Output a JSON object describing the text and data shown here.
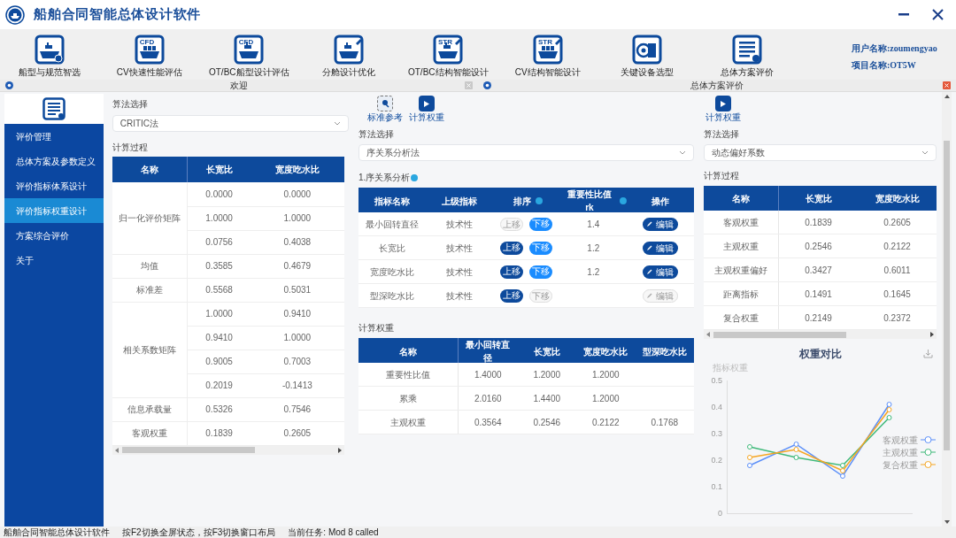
{
  "window": {
    "title": "船舶合同智能总体设计软件"
  },
  "toolbar": [
    {
      "label": "船型与规范智选"
    },
    {
      "label": "CV快速性能评估",
      "badge": "CFD"
    },
    {
      "label": "OT/BC船型设计评估",
      "badge": "CFD"
    },
    {
      "label": "分舱设计优化"
    },
    {
      "label": "OT/BC结构智能设计",
      "badge": "STR"
    },
    {
      "label": "CV结构智能设计",
      "badge": "STR"
    },
    {
      "label": "关键设备选型"
    },
    {
      "label": "总体方案评价"
    }
  ],
  "user": {
    "user_name": "用户名称:zoumengyao",
    "project_name": "项目名称:OT5W"
  },
  "panes": [
    {
      "title": "欢迎",
      "active": false
    },
    {
      "title": "总体方案评价",
      "active": true
    }
  ],
  "sidebar": {
    "items": [
      {
        "label": "评价管理",
        "selected": false
      },
      {
        "label": "总体方案及参数定义",
        "selected": false
      },
      {
        "label": "评价指标体系设计",
        "selected": false
      },
      {
        "label": "评价指标权重设计",
        "selected": true
      },
      {
        "label": "方案综合评价",
        "selected": false
      },
      {
        "label": "关于",
        "selected": false
      }
    ]
  },
  "critic": {
    "algorithm_label": "算法选择",
    "algorithm": "CRITIC法",
    "process_label": "计算过程",
    "columns": [
      "名称",
      "长宽比",
      "宽度吃水比"
    ],
    "groups": [
      {
        "name": "归一化评价矩阵",
        "rows": [
          [
            "0.0000",
            "0.0000"
          ],
          [
            "1.0000",
            "1.0000"
          ],
          [
            "0.0756",
            "0.4038"
          ]
        ]
      },
      {
        "name": "均值",
        "rows": [
          [
            "0.3585",
            "0.4679"
          ]
        ]
      },
      {
        "name": "标准差",
        "rows": [
          [
            "0.5568",
            "0.5031"
          ]
        ]
      },
      {
        "name": "相关系数矩阵",
        "rows": [
          [
            "1.0000",
            "0.9410"
          ],
          [
            "0.9410",
            "1.0000"
          ],
          [
            "0.9005",
            "0.7003"
          ],
          [
            "0.2019",
            "-0.1413"
          ]
        ]
      },
      {
        "name": "信息承载量",
        "rows": [
          [
            "0.5326",
            "0.7546"
          ]
        ]
      },
      {
        "name": "客观权重",
        "rows": [
          [
            "0.1839",
            "0.2605"
          ]
        ]
      }
    ]
  },
  "order": {
    "tools": [
      {
        "label": "标准参考"
      },
      {
        "label": "计算权重"
      }
    ],
    "algorithm_label": "算法选择",
    "algorithm": "序关系分析法",
    "section": "1.序关系分析",
    "columns": [
      {
        "label": "指标名称"
      },
      {
        "label": "上级指标"
      },
      {
        "label": "排序",
        "help": true
      },
      {
        "label": "重要性比值rk",
        "help": true
      },
      {
        "label": "操作"
      }
    ],
    "rows": [
      {
        "name": "最小回转直径",
        "parent": "技术性",
        "up": {
          "label": "上移",
          "disabled": true
        },
        "down": {
          "label": "下移",
          "disabled": false
        },
        "rk": "1.4",
        "edit": {
          "label": "编辑",
          "disabled": false
        }
      },
      {
        "name": "长宽比",
        "parent": "技术性",
        "up": {
          "label": "上移",
          "disabled": false
        },
        "down": {
          "label": "下移",
          "disabled": false
        },
        "rk": "1.2",
        "edit": {
          "label": "编辑",
          "disabled": false
        }
      },
      {
        "name": "宽度吃水比",
        "parent": "技术性",
        "up": {
          "label": "上移",
          "disabled": false
        },
        "down": {
          "label": "下移",
          "disabled": false
        },
        "rk": "1.2",
        "edit": {
          "label": "编辑",
          "disabled": false
        }
      },
      {
        "name": "型深吃水比",
        "parent": "技术性",
        "up": {
          "label": "上移",
          "disabled": false
        },
        "down": {
          "label": "下移",
          "disabled": true
        },
        "edit": {
          "label": "编辑",
          "disabled": true
        }
      }
    ],
    "weights_label": "计算权重",
    "weights_columns": [
      "名称",
      "最小回转直径",
      "长宽比",
      "宽度吃水比",
      "型深吃水比"
    ],
    "weights_rows": [
      [
        "重要性比值",
        "1.4000",
        "1.2000",
        "1.2000"
      ],
      [
        "累乘",
        "2.0160",
        "1.4400",
        "1.2000"
      ],
      [
        "主观权重",
        "0.3564",
        "0.2546",
        "0.2122",
        "0.1768"
      ]
    ]
  },
  "evaluation": {
    "tools": [
      {
        "label": "计算权重"
      }
    ],
    "algorithm_label": "算法选择",
    "algorithm": "动态偏好系数",
    "process_label": "计算过程",
    "columns": [
      "名称",
      "长宽比",
      "宽度吃水比"
    ],
    "rows": [
      [
        "客观权重",
        "0.1839",
        "0.2605"
      ],
      [
        "主观权重",
        "0.2546",
        "0.2122"
      ],
      [
        "主观权重偏好",
        "0.3427",
        "0.6011"
      ],
      [
        "距离指标",
        "0.1491",
        "0.1645"
      ],
      [
        "复合权重",
        "0.2149",
        "0.2372"
      ]
    ],
    "chart_data": {
      "type": "line",
      "title": "权重对比",
      "ylabel": "指标权重",
      "ylim": [
        0,
        0.5
      ],
      "yticks": [
        0,
        0.1,
        0.2,
        0.3,
        0.4,
        0.5
      ],
      "legend": "right",
      "series": [
        {
          "name": "客观权重",
          "color": "#5b8ff9",
          "marker": "circle",
          "values": [
            0.18,
            0.26,
            0.14,
            0.41
          ]
        },
        {
          "name": "主观权重",
          "color": "#3fb97a",
          "marker": "circle",
          "values": [
            0.25,
            0.21,
            0.18,
            0.36
          ]
        },
        {
          "name": "复合权重",
          "color": "#f5a623",
          "marker": "circle",
          "values": [
            0.21,
            0.24,
            0.16,
            0.39
          ]
        }
      ]
    }
  },
  "status_bar": [
    "船舶合同智能总体设计软件",
    "按F2切换全屏状态，按F3切换窗口布局",
    "当前任务: Mod 8 called"
  ]
}
